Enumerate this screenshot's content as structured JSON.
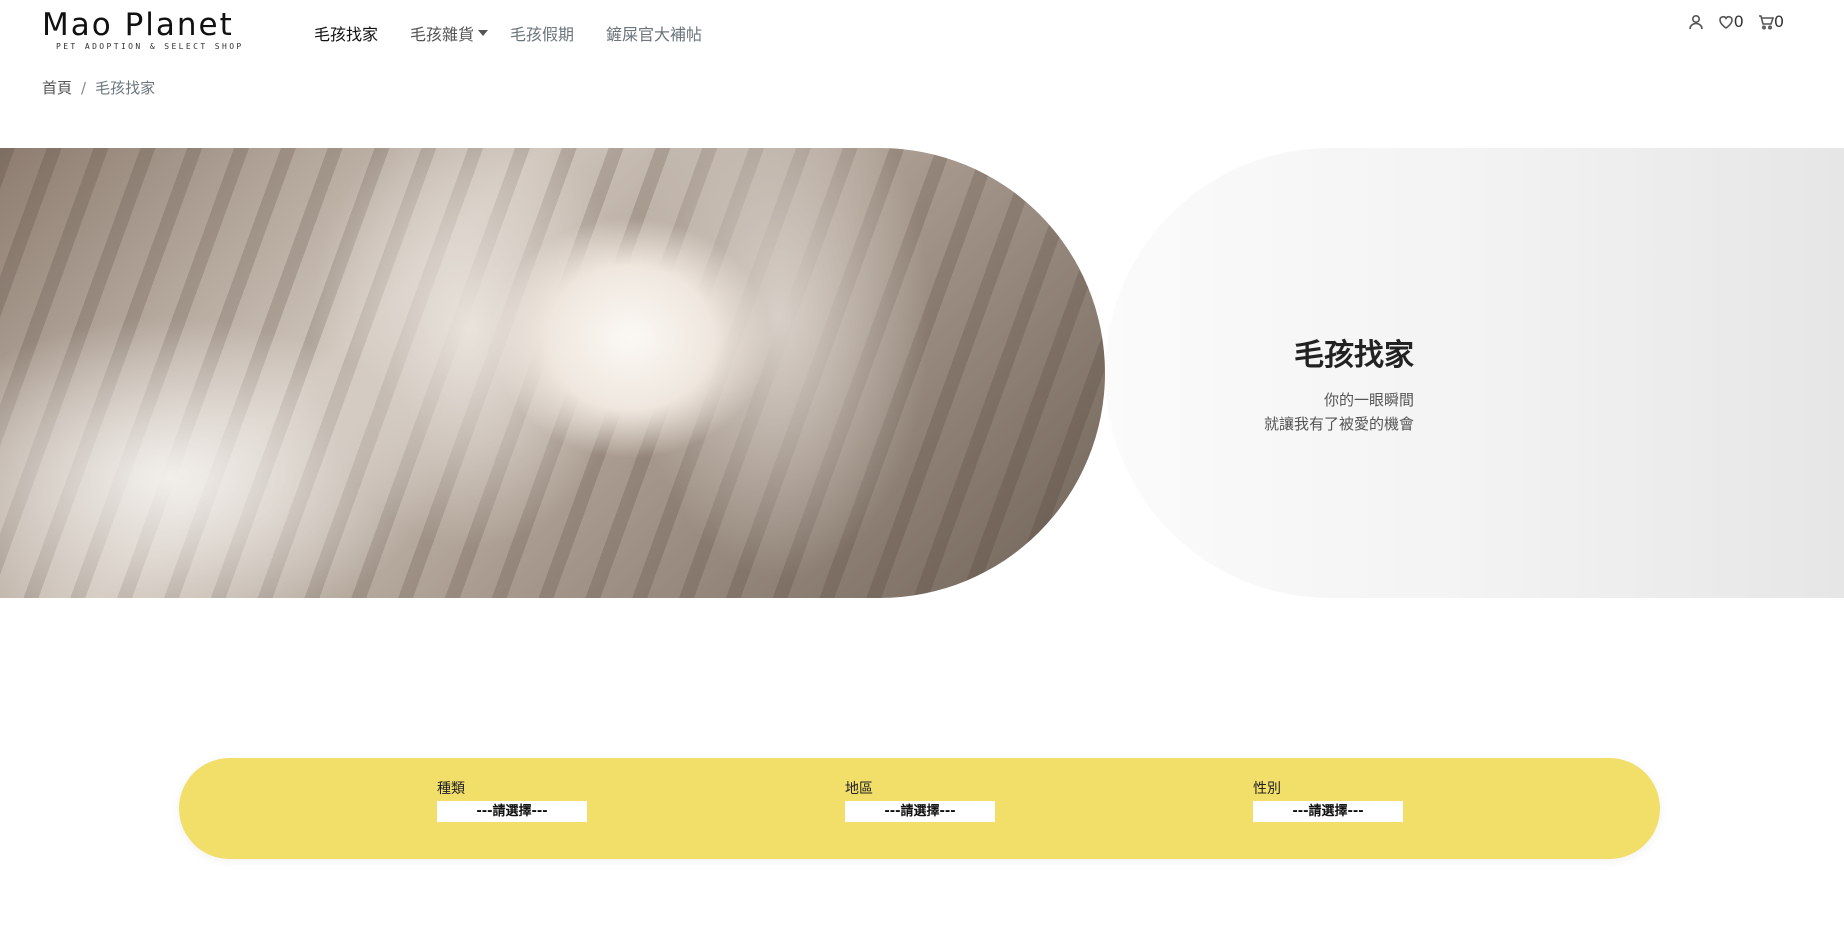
{
  "header": {
    "logo_title": "Mao Planet",
    "logo_subtitle": "PET ADOPTION & SELECT SHOP",
    "nav": [
      {
        "label": "毛孩找家",
        "active": true
      },
      {
        "label": "毛孩雜貨",
        "dropdown": true
      },
      {
        "label": "毛孩假期"
      },
      {
        "label": "鏟屎官大補帖"
      }
    ],
    "icons": {
      "account": "user-icon",
      "wishlist": "heart-icon",
      "wishlist_count": "0",
      "cart": "cart-icon",
      "cart_count": "0"
    }
  },
  "breadcrumb": {
    "home": "首頁",
    "separator": "/",
    "current": "毛孩找家"
  },
  "hero": {
    "title": "毛孩找家",
    "line1": "你的一眼瞬間",
    "line2": "就讓我有了被愛的機會"
  },
  "filters": [
    {
      "label": "種類",
      "selected": "---請選擇---"
    },
    {
      "label": "地區",
      "selected": "---請選擇---"
    },
    {
      "label": "性別",
      "selected": "---請選擇---"
    }
  ],
  "colors": {
    "filter_bar": "#f2df69",
    "text_dark": "#212529",
    "text_muted": "#6c757d"
  }
}
